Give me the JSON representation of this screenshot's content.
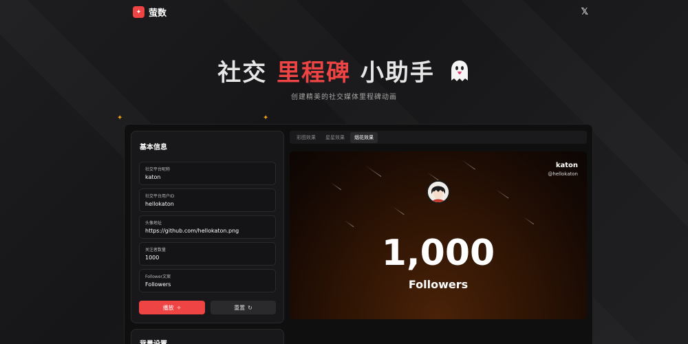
{
  "brand": {
    "name": "萤数",
    "logo_icon": "sparkle-icon",
    "accent": "#ef4444"
  },
  "header": {
    "social_icon": "x-logo-icon"
  },
  "hero": {
    "title_part1": "社交",
    "title_part2": "里程碑",
    "title_part3": "小助手",
    "emoji_icon": "ghost-icon",
    "subtitle": "创建精美的社交媒体里程碑动画"
  },
  "form": {
    "title": "基本信息",
    "fields": [
      {
        "label": "社交平台昵称",
        "value": "katon"
      },
      {
        "label": "社交平台用户ID",
        "value": "hellokaton"
      },
      {
        "label": "头像地址",
        "value": "https://github.com/hellokaton.png"
      },
      {
        "label": "关注者数量",
        "value": "1000"
      },
      {
        "label": "Follower文案",
        "value": "Followers"
      }
    ],
    "play_label": "播放",
    "reset_label": "重置"
  },
  "background_panel": {
    "title": "背景设置"
  },
  "tabs": [
    {
      "label": "彩图效果",
      "active": false
    },
    {
      "label": "星星效果",
      "active": false
    },
    {
      "label": "烟花效果",
      "active": true
    }
  ],
  "preview": {
    "name": "katon",
    "handle": "@hellokaton",
    "count": "1,000",
    "label": "Followers"
  }
}
